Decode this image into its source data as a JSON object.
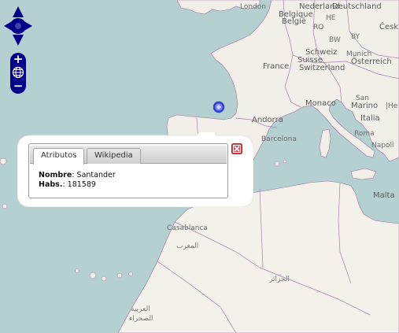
{
  "map": {
    "colors": {
      "sea": "#b5d0d0",
      "land": "#f2efe9",
      "desert": "#f4f1ea",
      "border": "#9e6fa6",
      "control": "#00008b",
      "marker": "#2a3fd6"
    },
    "labels": [
      {
        "id": "london",
        "text": "London",
        "cls": "cap"
      },
      {
        "id": "nederland",
        "text": "Nederland",
        "cls": "big"
      },
      {
        "id": "deutschland",
        "text": "Deutschland",
        "cls": "big"
      },
      {
        "id": "belgique",
        "text": "Belgique",
        "cls": "big"
      },
      {
        "id": "belgie",
        "text": "België",
        "cls": "big"
      },
      {
        "id": "he",
        "text": "HE",
        "cls": ""
      },
      {
        "id": "cesk",
        "text": "Česk",
        "cls": "big"
      },
      {
        "id": "ro",
        "text": "RO",
        "cls": ""
      },
      {
        "id": "bw",
        "text": "BW",
        "cls": ""
      },
      {
        "id": "by",
        "text": "BY",
        "cls": ""
      },
      {
        "id": "munich",
        "text": "Munich",
        "cls": ""
      },
      {
        "id": "osterreich",
        "text": "Österreich",
        "cls": "big"
      },
      {
        "id": "schweiz",
        "text": "Schweiz",
        "cls": "big"
      },
      {
        "id": "suisse",
        "text": "Suisse",
        "cls": "big"
      },
      {
        "id": "switzerland",
        "text": "Switzerland",
        "cls": "big"
      },
      {
        "id": "france",
        "text": "France",
        "cls": "big"
      },
      {
        "id": "monaco",
        "text": "Monaco",
        "cls": "big"
      },
      {
        "id": "san",
        "text": "San",
        "cls": ""
      },
      {
        "id": "marino",
        "text": "Marino",
        "cls": "big"
      },
      {
        "id": "he2",
        "text": "|He",
        "cls": ""
      },
      {
        "id": "italia",
        "text": "Italia",
        "cls": "big"
      },
      {
        "id": "roma",
        "text": "Roma",
        "cls": ""
      },
      {
        "id": "andorra",
        "text": "Andorra",
        "cls": "big"
      },
      {
        "id": "barcelona",
        "text": "Barcelona",
        "cls": ""
      },
      {
        "id": "napoli",
        "text": "Napoli",
        "cls": ""
      },
      {
        "id": "malta",
        "text": "Malta",
        "cls": "big"
      },
      {
        "id": "casablanca",
        "text": "Casablanca",
        "cls": ""
      },
      {
        "id": "maghreb",
        "text": "المغرب",
        "cls": "arabic"
      },
      {
        "id": "jazair",
        "text": "الجزائر",
        "cls": "arabic"
      },
      {
        "id": "arabia",
        "text": "العربية",
        "cls": "arabic"
      },
      {
        "id": "sahara",
        "text": "الصحراء",
        "cls": "arabic"
      }
    ]
  },
  "controls": {
    "pan_up": "pan-up",
    "pan_down": "pan-down",
    "pan_left": "pan-left",
    "pan_right": "pan-right",
    "zoom_in": "+",
    "zoom_out": "−",
    "world": "zoom-world"
  },
  "popup": {
    "tabs": [
      "Atributos",
      "Wikipedia"
    ],
    "active_tab": 0,
    "fields": [
      {
        "label": "Nombre",
        "sep": ": ",
        "value": "Santander"
      },
      {
        "label": "Habs.",
        "sep": ": ",
        "value": "181589"
      }
    ],
    "close_color": "#d9474f"
  }
}
